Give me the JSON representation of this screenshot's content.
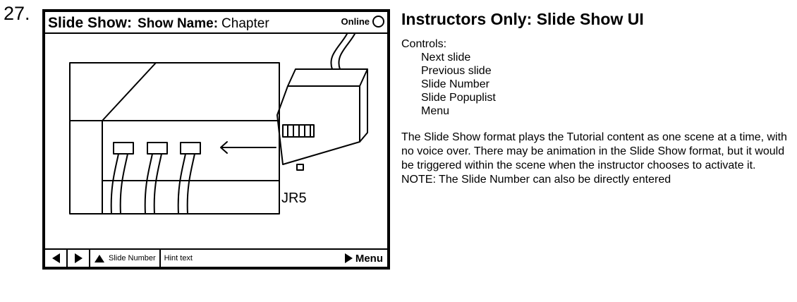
{
  "item_number": "27.",
  "window": {
    "title": "Slide Show:",
    "show_name_label": "Show Name:",
    "show_name_value": "Chapter",
    "status_label": "Online",
    "status_icon": "circle-icon"
  },
  "slide": {
    "connector_label": "JR5"
  },
  "bottom_bar": {
    "prev_icon": "triangle-left-icon",
    "next_icon": "triangle-right-icon",
    "slide_number_label": "Slide Number",
    "hint_text": "Hint text",
    "menu_label": "Menu"
  },
  "notes": {
    "heading": "Instructors Only: Slide Show UI",
    "controls_label": "Controls:",
    "controls": [
      "Next slide",
      "Previous slide",
      "Slide Number",
      "Slide Popuplist",
      "Menu"
    ],
    "description": "The Slide Show format plays the Tutorial content as one scene at a time, with no voice over.  There may be animation in the Slide Show format, but it would be triggered within the scene when the instructor chooses to activate it.",
    "note": "NOTE: The Slide Number can also be directly entered"
  }
}
